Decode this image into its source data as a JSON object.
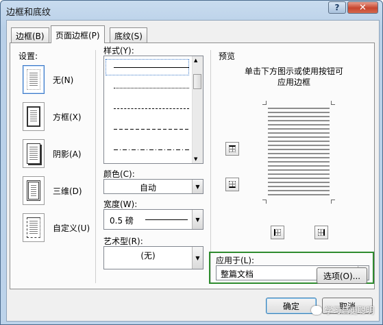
{
  "window": {
    "title": "边框和底纹",
    "help_label": "?",
    "close_label": "✕"
  },
  "tabs": [
    {
      "label": "边框(B)",
      "active": false
    },
    {
      "label": "页面边框(P)",
      "active": true
    },
    {
      "label": "底纹(S)",
      "active": false
    }
  ],
  "settings": {
    "label": "设置:",
    "items": [
      {
        "label": "无(N)",
        "icon": "no-border-page-icon",
        "selected": true
      },
      {
        "label": "方框(X)",
        "icon": "box-border-page-icon"
      },
      {
        "label": "阴影(A)",
        "icon": "shadow-border-page-icon"
      },
      {
        "label": "三维(D)",
        "icon": "3d-border-page-icon"
      },
      {
        "label": "自定义(U)",
        "icon": "custom-border-page-icon"
      }
    ]
  },
  "style": {
    "label": "样式(Y):",
    "options": [
      "solid",
      "dotted",
      "dashed-small",
      "dashed",
      "dash-dot"
    ]
  },
  "color": {
    "label": "颜色(C):",
    "value": "自动"
  },
  "width": {
    "label": "宽度(W):",
    "value": "0.5 磅"
  },
  "art": {
    "label": "艺术型(R):",
    "value": "(无)"
  },
  "preview": {
    "label": "预览",
    "hint_line1": "单击下方图示或使用按钮可",
    "hint_line2": "应用边框"
  },
  "apply_to": {
    "label": "应用于(L):",
    "value": "整篇文档"
  },
  "buttons": {
    "options": "选项(O)...",
    "ok": "确定",
    "cancel": "取消"
  },
  "watermark": {
    "text": "学习启更聪明"
  },
  "colors": {
    "highlight_border": "#2e8b2e",
    "close_red": "#c6452f"
  }
}
